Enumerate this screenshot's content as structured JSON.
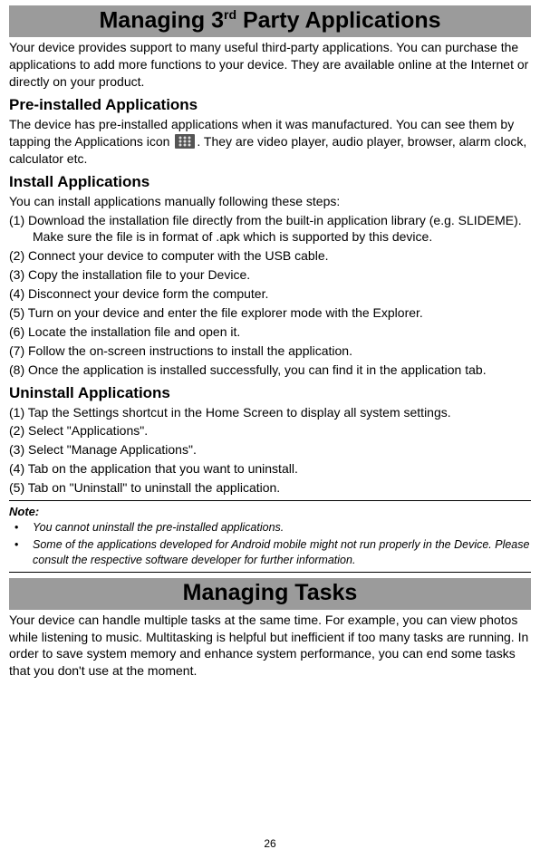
{
  "banner1_prefix": "Managing 3",
  "banner1_sup": "rd",
  "banner1_suffix": " Party Applications",
  "intro1": "Your device provides support to many useful third-party applications. You can purchase the applications to add more functions to your device. They are available online at the Internet or directly on your product.",
  "h_preinstalled": "Pre-installed Applications",
  "preinstalled_a": "The device has pre-installed applications when it was manufactured. You can see them by tapping the Applications icon ",
  "preinstalled_b": ". They are video player, audio player, browser, alarm clock, calculator etc.",
  "h_install": "Install Applications",
  "install_intro": "You can install applications manually following these steps:",
  "install_steps": [
    "(1) Download the installation file directly from the built-in application library (e.g. SLIDEME). Make sure the file is in format of .apk which is supported by this device.",
    "(2) Connect your device to computer with the USB cable.",
    "(3) Copy the installation file to your Device.",
    "(4) Disconnect your device form the computer.",
    "(5) Turn on your device and enter the file explorer mode with the Explorer.",
    "(6) Locate the installation file and open it.",
    "(7) Follow the on-screen instructions to install the application.",
    "(8) Once the application is installed successfully, you can find it in the application tab."
  ],
  "h_uninstall": "Uninstall Applications",
  "uninstall_steps": [
    "(1) Tap the Settings shortcut in the Home Screen to display all system settings.",
    "(2) Select \"Applications\".",
    "(3) Select \"Manage Applications\".",
    "(4) Tab on the application that you want to uninstall.",
    "(5) Tab on \"Uninstall\" to uninstall the application."
  ],
  "note_title": "Note:",
  "notes": [
    "You cannot uninstall the pre-installed applications.",
    "Some of the applications developed for Android mobile might not run properly in the Device. Please consult the respective software developer for further information."
  ],
  "banner2": "Managing Tasks",
  "tasks_para": "Your device can handle multiple tasks at the same time. For example, you can view photos while listening to music. Multitasking is helpful but inefficient if too many tasks are running. In order to save system memory and enhance system performance, you can end some tasks that you don't use at the moment.",
  "page_number": "26"
}
